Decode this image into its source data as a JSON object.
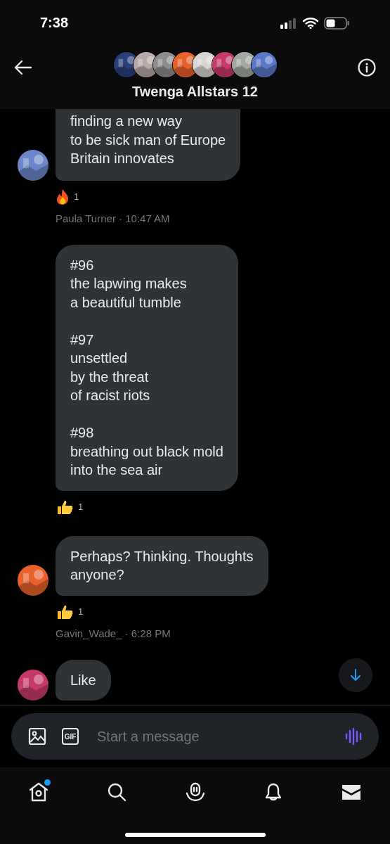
{
  "status_bar": {
    "time": "7:38"
  },
  "header": {
    "title": "Twenga Allstars 12",
    "avatars": [
      {
        "kind": "picture",
        "color": "#2a3f7a"
      },
      {
        "kind": "picture",
        "color": "#b9a9a6"
      },
      {
        "kind": "picture",
        "color": "#8d8d8d"
      },
      {
        "kind": "picture",
        "color": "#e8602c"
      },
      {
        "kind": "picture",
        "color": "#d9d6d2"
      },
      {
        "kind": "picture",
        "color": "#c63a6b"
      },
      {
        "kind": "picture",
        "color": "#a3a9a0"
      },
      {
        "kind": "picture",
        "color": "#5a78c8"
      }
    ]
  },
  "messages": [
    {
      "clipped_top": true,
      "avatar": {
        "kind": "picture",
        "color": "#6c86c9"
      },
      "lines": [
        "finding a new way",
        "to be sick man of Europe",
        "Britain innovates"
      ],
      "reaction": {
        "kind": "fire",
        "count": "1"
      },
      "meta": "Paula Turner · 10:47 AM"
    },
    {
      "clipped_top": false,
      "lines": [
        "#96",
        "the lapwing makes",
        "a beautiful tumble"
      ],
      "stanzas": [
        [
          "#97",
          "unsettled",
          "by the threat",
          "of racist riots"
        ],
        [
          "#98",
          "breathing out black mold",
          "into the sea air"
        ]
      ],
      "reaction": {
        "kind": "thumbs",
        "count": "1"
      }
    },
    {
      "clipped_top": false,
      "avatar": {
        "kind": "picture",
        "color": "#e8602c"
      },
      "lines": [
        "Perhaps? Thinking. Thoughts",
        "anyone?"
      ],
      "reaction": {
        "kind": "thumbs",
        "count": "1"
      },
      "meta": "Gavin_Wade_ · 6:28 PM"
    },
    {
      "clipped_top": false,
      "avatar": {
        "kind": "picture",
        "color": "#c63a6b"
      },
      "lines": [
        "Like"
      ]
    }
  ],
  "composer": {
    "gif_label": "GIF",
    "placeholder": "Start a message"
  },
  "nav": [
    {
      "kind": "home",
      "badge": true
    },
    {
      "kind": "search",
      "badge": false
    },
    {
      "kind": "spaces",
      "badge": false
    },
    {
      "kind": "notifications",
      "badge": false
    },
    {
      "kind": "messages",
      "badge": false
    }
  ]
}
